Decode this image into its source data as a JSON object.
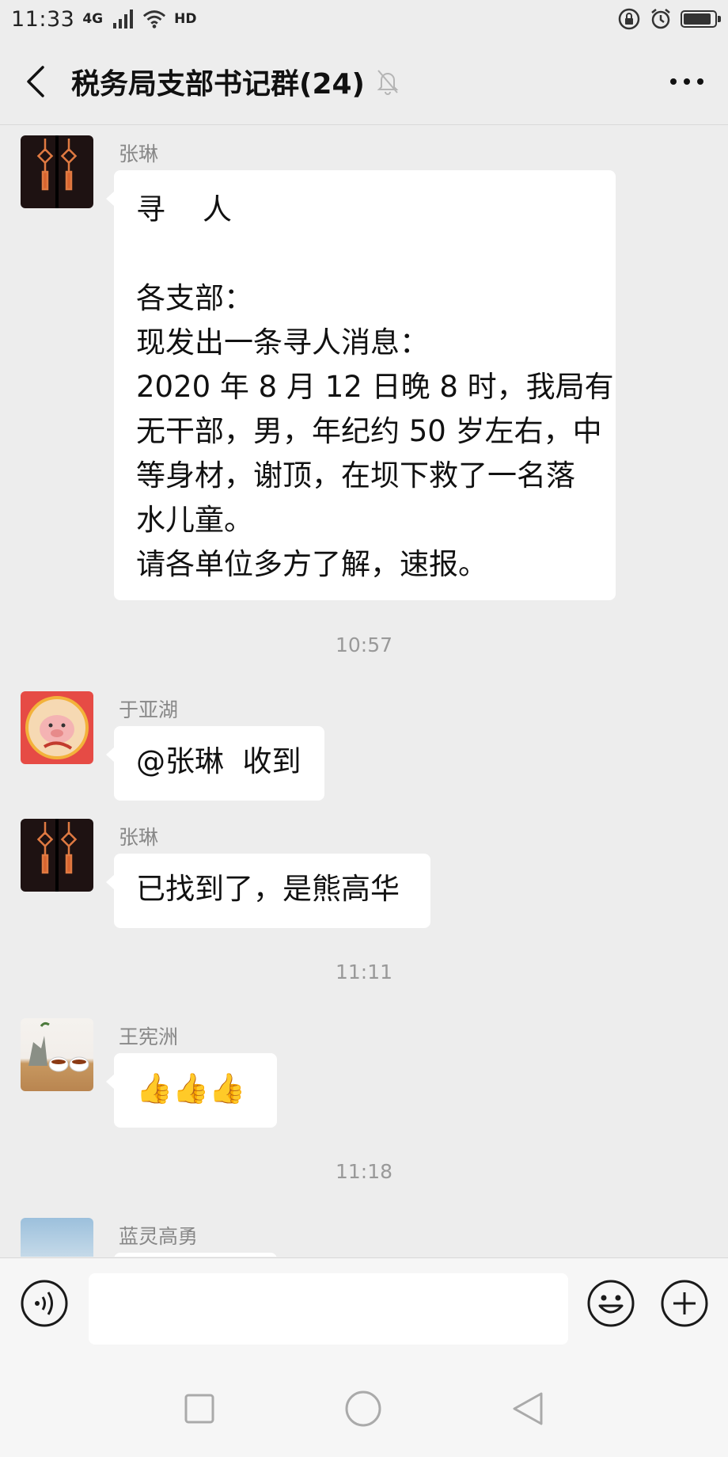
{
  "status_bar": {
    "time": "11:33",
    "network": "4G",
    "hd": "HD"
  },
  "header": {
    "title": "税务局支部书记群(24)"
  },
  "messages": [
    {
      "sender": "张琳",
      "avatar": "chinese-knot-avatar",
      "lines": [
        "寻    人",
        "",
        "各支部：",
        "现发出一条寻人消息：",
        "2020 年 8 月 12 日晚 8 时，我局有",
        "无干部，男，年纪约 50 岁左右，中",
        "等身材，谢顶，在坝下救了一名落",
        "水儿童。",
        "请各单位多方了解，速报。"
      ]
    },
    {
      "sender": "于亚湖",
      "avatar": "zodiac-pig-avatar",
      "text": "@张琳  收到"
    },
    {
      "sender": "张琳",
      "avatar": "chinese-knot-avatar",
      "text": "已找到了，是熊高华"
    },
    {
      "sender": "王宪洲",
      "avatar": "tea-set-avatar",
      "text": "👍👍👍"
    },
    {
      "sender": "蓝灵高勇",
      "avatar": "sky-avatar",
      "text": ""
    }
  ],
  "timestamps": [
    "10:57",
    "11:11",
    "11:18"
  ],
  "input": {
    "value": "",
    "placeholder": ""
  },
  "colors": {
    "background": "#ededed",
    "bubble": "#ffffff",
    "secondary_text": "#888888"
  }
}
